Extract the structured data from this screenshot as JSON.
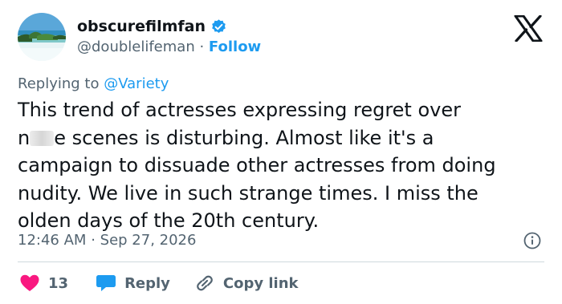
{
  "author": {
    "display_name": "obscurefilmfan",
    "handle": "@doublelifeman",
    "separator": "·",
    "follow_label": "Follow",
    "verified_color": "#1d9bf0"
  },
  "reply_context": {
    "prefix": "Replying to",
    "mention": "@Variety"
  },
  "tweet": {
    "line1": "This trend of actresses expressing regret over",
    "line2_start": "n",
    "line2_end": "e scenes is disturbing. Almost like it's a",
    "line3": "campaign to dissuade other actresses from doing",
    "line4": "nudity. We live in such strange times. I miss the",
    "line5": "olden days of the 20th century."
  },
  "meta": {
    "time": "12:46 AM",
    "separator": "·",
    "date": "Sep 27, 2026"
  },
  "actions": {
    "like_count": "13",
    "reply_label": "Reply",
    "copy_label": "Copy link"
  },
  "colors": {
    "accent": "#1d9bf0",
    "like": "#f91880",
    "secondary_text": "#536471",
    "divider": "#cfd9de"
  },
  "icons": [
    "verified-badge-icon",
    "x-logo-icon",
    "info-icon",
    "heart-icon",
    "reply-bubble-icon",
    "link-icon"
  ]
}
